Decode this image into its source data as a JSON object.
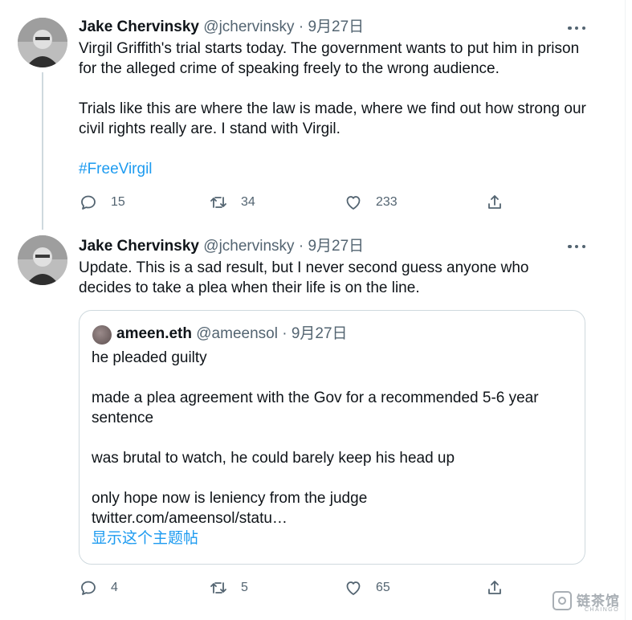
{
  "tweet1": {
    "author_name": "Jake Chervinsky",
    "handle": "@jchervinsky",
    "separator": "·",
    "date": "9月27日",
    "paragraphs": [
      "Virgil Griffith's trial starts today. The government wants to put him in prison for the alleged crime of speaking freely to the wrong audience.",
      "Trials like this are where the law is made, where we find out how strong our civil rights really are. I stand with Virgil."
    ],
    "hashtag": "#FreeVirgil",
    "replies": "15",
    "retweets": "34",
    "likes": "233"
  },
  "tweet2": {
    "author_name": "Jake Chervinsky",
    "handle": "@jchervinsky",
    "separator": "·",
    "date": "9月27日",
    "text": "Update. This is a sad result, but I never second guess anyone who decides to take a plea when their life is on the line.",
    "replies": "4",
    "retweets": "5",
    "likes": "65",
    "quote": {
      "author_name": "ameen.eth",
      "handle": "@ameensol",
      "separator": "·",
      "date": "9月27日",
      "lines": [
        "he pleaded guilty",
        "made a plea agreement with the Gov for a recommended 5-6 year sentence",
        "was brutal to watch, he could barely keep his head up",
        "only hope now is leniency from the judge"
      ],
      "link": "twitter.com/ameensol/statu…",
      "show_thread": "显示这个主题帖"
    }
  },
  "watermark": {
    "text": "链茶馆",
    "sub": "CHAINGO"
  },
  "colors": {
    "accent": "#1d9bf0",
    "text_primary": "#0f1419",
    "text_secondary": "#536471",
    "border": "#cfd9de"
  },
  "icons": {
    "reply": "speech-bubble-icon",
    "retweet": "retweet-arrows-icon",
    "like": "heart-outline-icon",
    "share": "share-upload-icon",
    "more": "more-horizontal-icon"
  }
}
